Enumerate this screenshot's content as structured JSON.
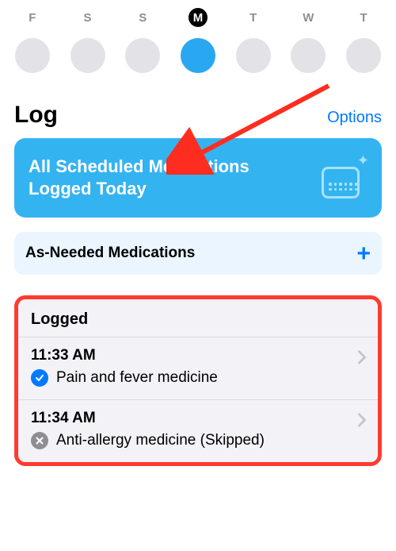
{
  "daySelector": {
    "days": [
      {
        "letter": "F",
        "selected": false
      },
      {
        "letter": "S",
        "selected": false
      },
      {
        "letter": "S",
        "selected": false
      },
      {
        "letter": "M",
        "selected": true
      },
      {
        "letter": "T",
        "selected": false
      },
      {
        "letter": "W",
        "selected": false
      },
      {
        "letter": "T",
        "selected": false
      }
    ]
  },
  "header": {
    "title": "Log",
    "optionsLabel": "Options"
  },
  "banner": {
    "text": "All Scheduled Medications Logged Today"
  },
  "asNeeded": {
    "label": "As-Needed Medications"
  },
  "loggedSection": {
    "title": "Logged",
    "entries": [
      {
        "time": "11:33 AM",
        "name": "Pain and fever medicine",
        "status": "taken",
        "suffix": ""
      },
      {
        "time": "11:34 AM",
        "name": "Anti-allergy medicine",
        "status": "skipped",
        "suffix": "  (Skipped)"
      }
    ]
  },
  "colors": {
    "accent": "#007aff",
    "bannerBg": "#34b3f1",
    "highlight": "#ff3b30"
  }
}
